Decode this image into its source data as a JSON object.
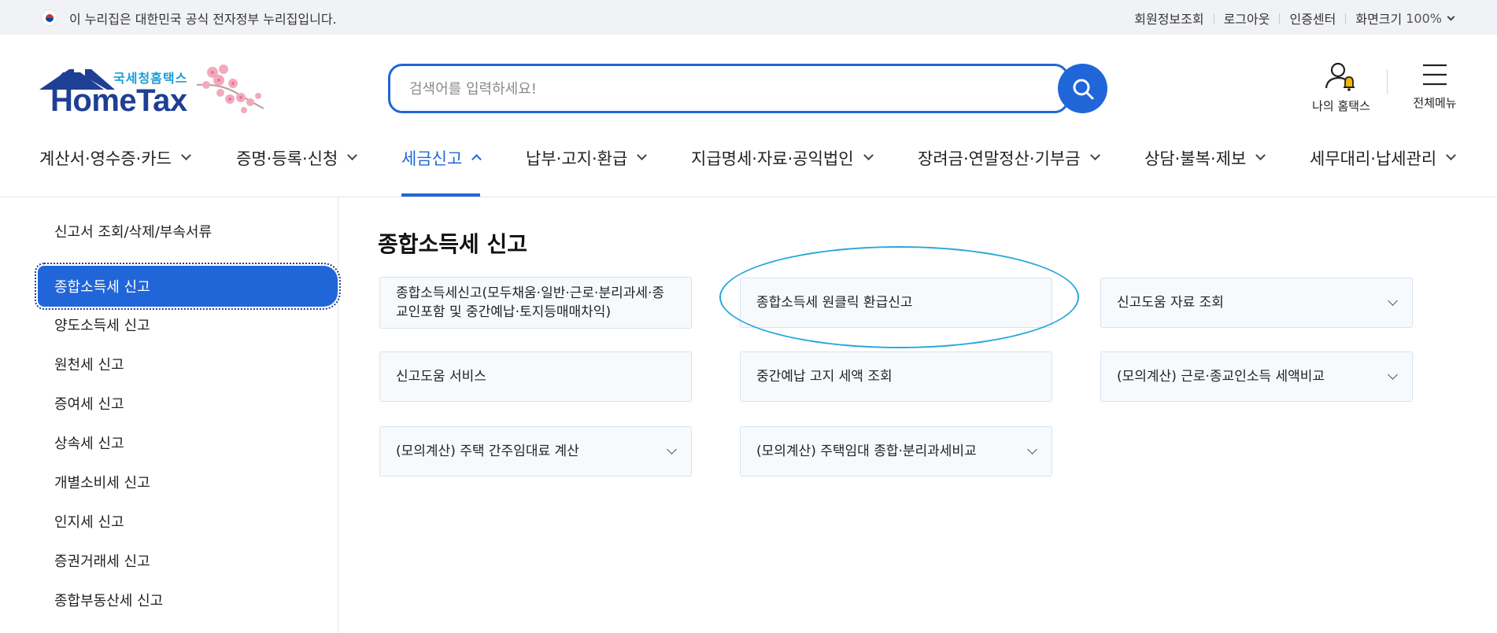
{
  "topbar": {
    "gov_notice": "이 누리집은 대한민국 공식 전자정부 누리집입니다.",
    "links": [
      "회원정보조회",
      "로그아웃",
      "인증센터"
    ],
    "zoom_label": "화면크기",
    "zoom_value": "100%"
  },
  "logo": {
    "sub": "국세청홈택스",
    "main": "HomeTax"
  },
  "search": {
    "placeholder": "검색어를 입력하세요!"
  },
  "header_actions": {
    "my_hometax": "나의 홈택스",
    "all_menu": "전체메뉴"
  },
  "gnb": {
    "items": [
      "계산서·영수증·카드",
      "증명·등록·신청",
      "세금신고",
      "납부·고지·환급",
      "지급명세·자료·공익법인",
      "장려금·연말정산·기부금",
      "상담·불복·제보",
      "세무대리·납세관리"
    ],
    "active_index": 2
  },
  "lnb": {
    "items": [
      "신고서 조회/삭제/부속서류",
      "종합소득세 신고",
      "양도소득세 신고",
      "원천세 신고",
      "증여세 신고",
      "상속세 신고",
      "개별소비세 신고",
      "인지세 신고",
      "증권거래세 신고",
      "종합부동산세 신고"
    ],
    "active_index": 1
  },
  "content": {
    "title": "종합소득세 신고",
    "cards": [
      "종합소득세신고(모두채움·일반·근로·분리과세·종교인포함 및 중간예납·토지등매매차익)",
      "종합소득세 원클릭 환급신고",
      "신고도움 자료 조회",
      "신고도움 서비스",
      "중간예납 고지 세액 조회",
      "(모의계산) 근로·종교인소득 세액비교",
      "(모의계산) 주택 간주임대료 계산",
      "(모의계산) 주택임대 종합·분리과세비교"
    ]
  },
  "colors": {
    "primary": "#2166d8",
    "brand_navy": "#1e3f94",
    "highlight": "#2aa7dc"
  }
}
